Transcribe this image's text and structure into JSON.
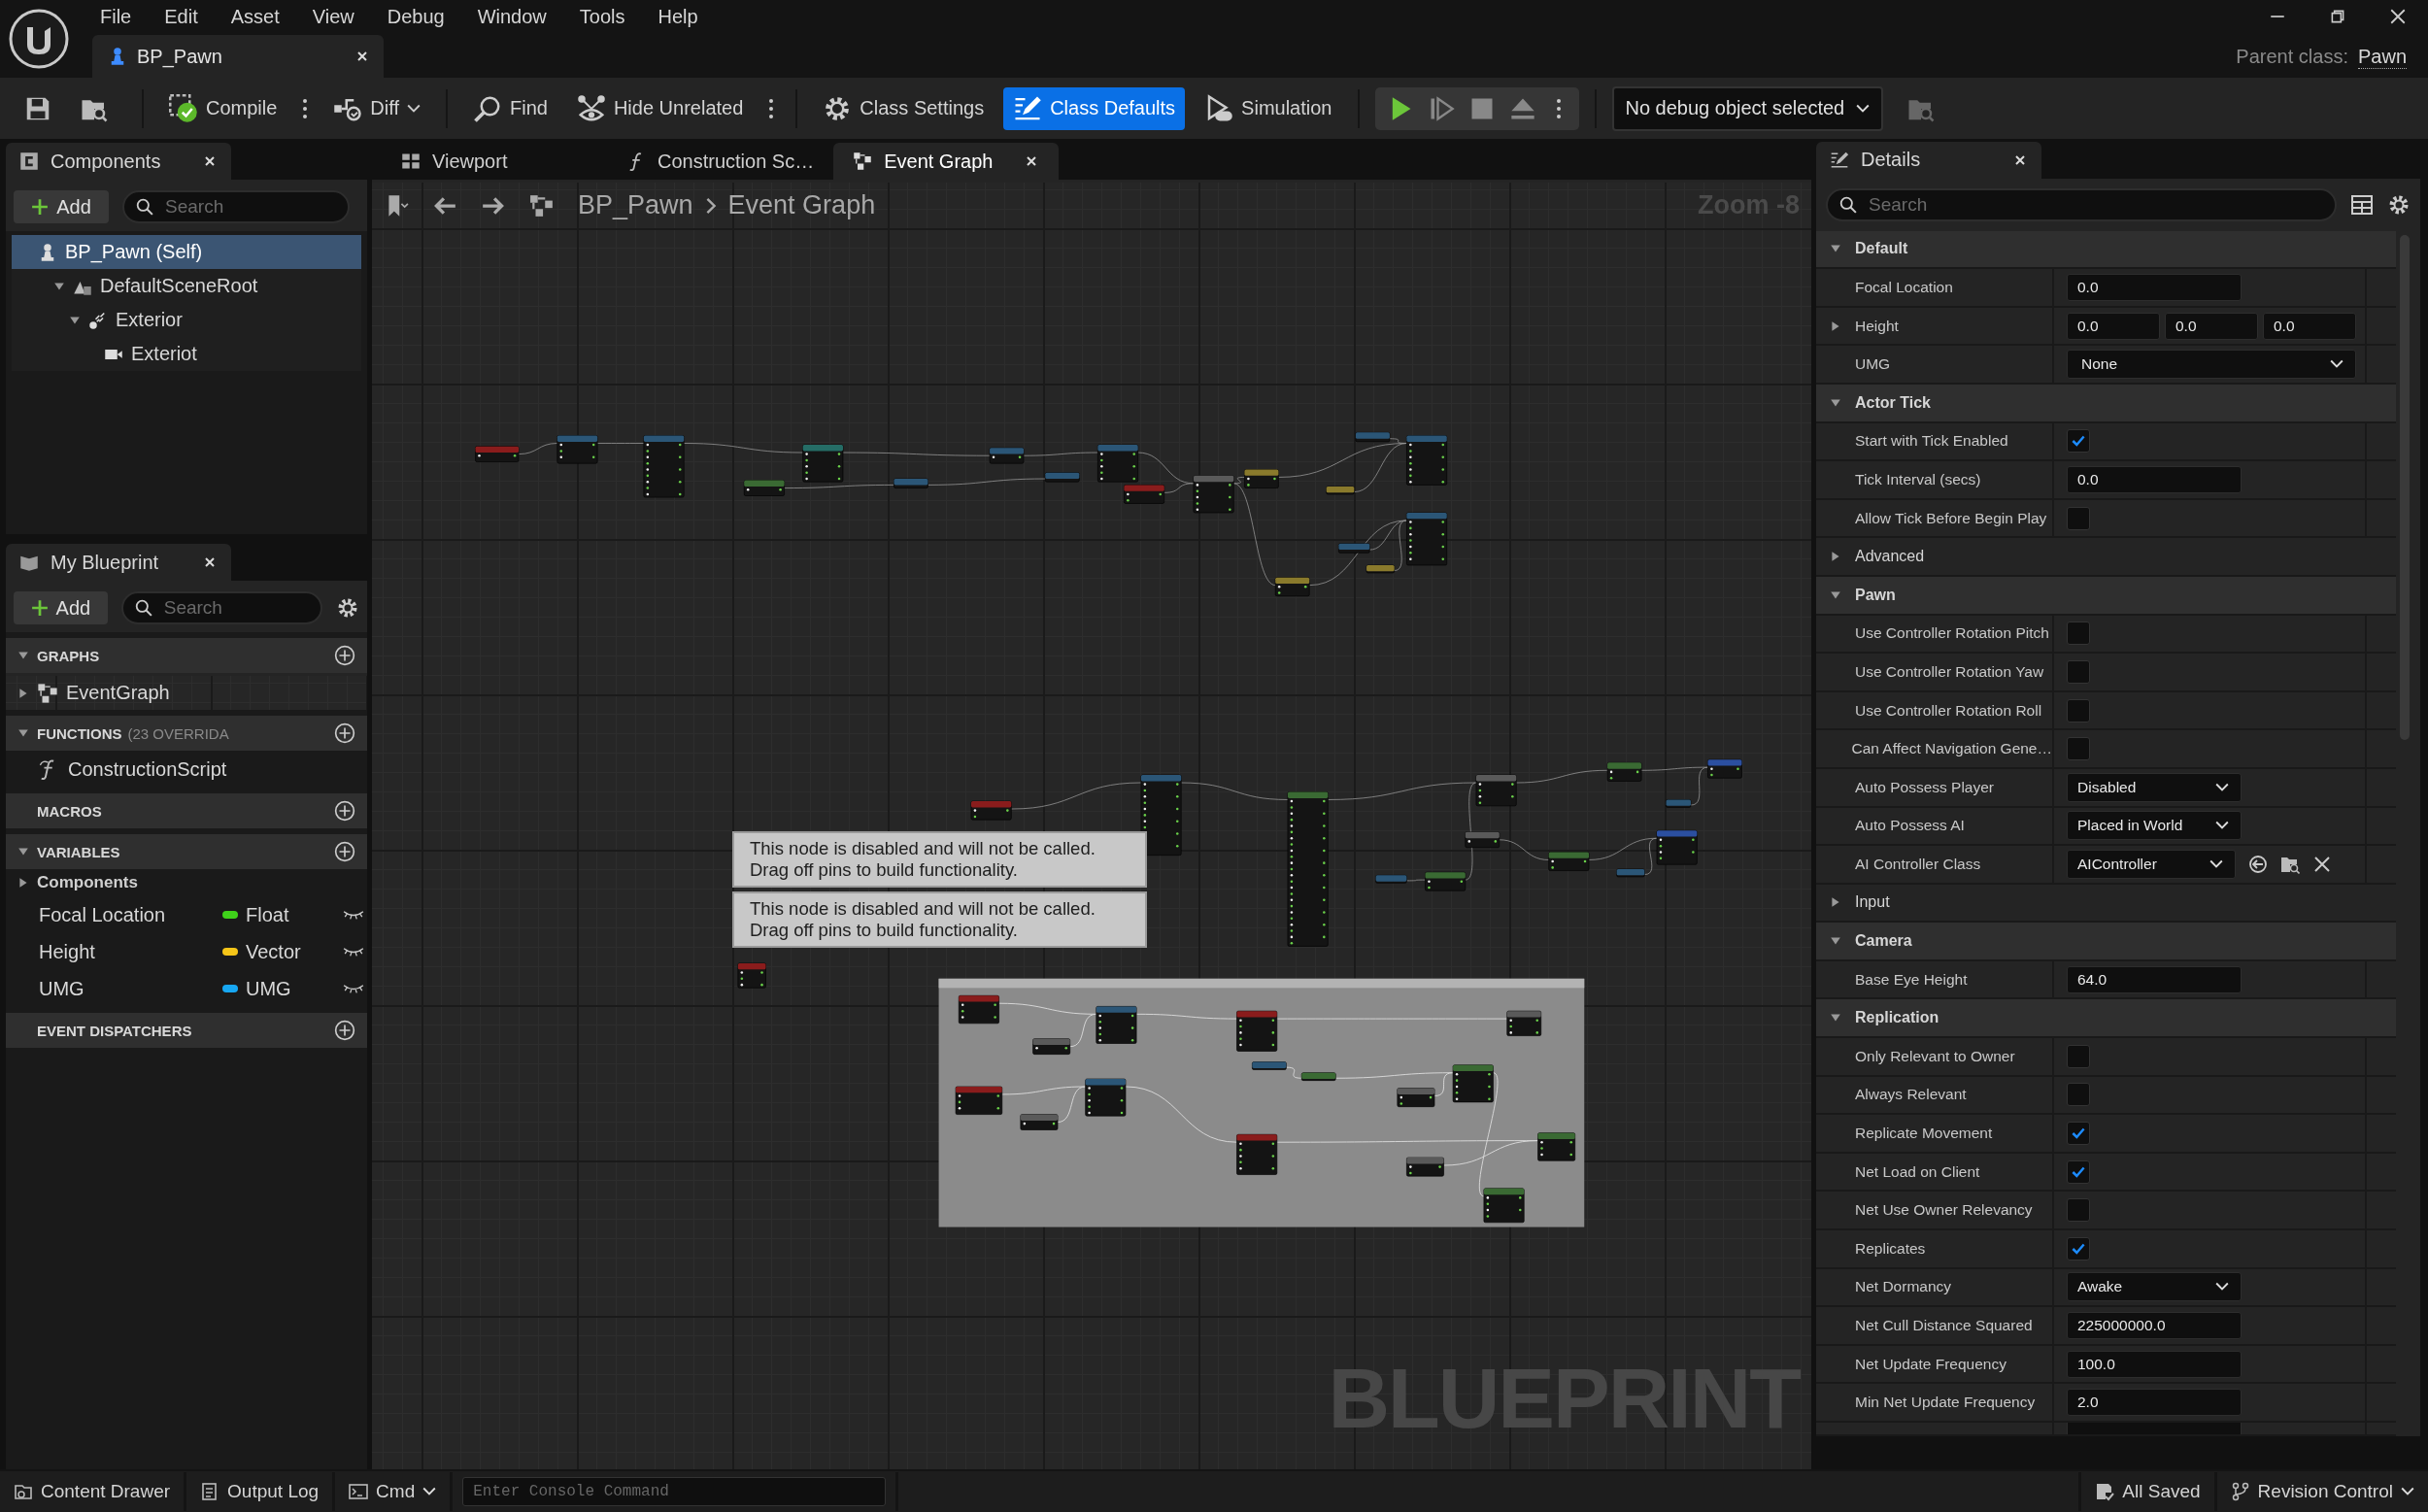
{
  "menu": [
    "File",
    "Edit",
    "Asset",
    "View",
    "Debug",
    "Window",
    "Tools",
    "Help"
  ],
  "document_tab": {
    "label": "BP_Pawn"
  },
  "parent_class": {
    "label": "Parent class:",
    "value": "Pawn"
  },
  "toolbar": {
    "groups": [
      [
        {
          "label": "Compile",
          "kind": "compile",
          "selected": false
        },
        {
          "label": "Diff",
          "kind": "diff",
          "selected": false
        }
      ],
      [
        {
          "label": "Find",
          "kind": "find",
          "selected": false
        },
        {
          "label": "Hide Unrelated",
          "kind": "hide",
          "selected": false
        }
      ],
      [
        {
          "label": "Class Settings",
          "kind": "settings",
          "selected": false
        },
        {
          "label": "Class Defaults",
          "kind": "defaults",
          "selected": true
        },
        {
          "label": "Simulation",
          "kind": "simulation",
          "selected": false
        }
      ]
    ],
    "debug_object": "No debug object selected"
  },
  "components": {
    "title": "Components",
    "add": "Add",
    "search_placeholder": "Search",
    "tree": [
      {
        "label": "BP_Pawn (Self)",
        "kind": "self",
        "selected": true,
        "children": [
          {
            "label": "DefaultSceneRoot",
            "kind": "scene",
            "selected": false,
            "expanded": true,
            "children": [
              {
                "label": "Exterior",
                "kind": "spring",
                "selected": false,
                "expanded": true,
                "children": [
                  {
                    "label": "Exteriot",
                    "kind": "camera",
                    "selected": false
                  }
                ]
              }
            ]
          }
        ]
      }
    ]
  },
  "my_blueprint": {
    "title": "My Blueprint",
    "add": "Add",
    "search_placeholder": "Search",
    "sections": [
      {
        "title": "GRAPHS",
        "expanded": true,
        "items": [
          {
            "label": "EventGraph",
            "kind": "graph",
            "expanded": false
          }
        ]
      },
      {
        "title": "FUNCTIONS",
        "note": "(23 OVERRIDA",
        "expanded": true,
        "items": [
          {
            "label": "ConstructionScript",
            "kind": "function"
          }
        ]
      },
      {
        "title": "MACROS"
      },
      {
        "title": "VARIABLES",
        "expanded": true,
        "items": [
          {
            "label": "Components",
            "kind": "category",
            "expanded": false
          },
          {
            "label": "Focal Location",
            "kind": "variable",
            "type": "Float",
            "color": "#3fd21a"
          },
          {
            "label": "Height",
            "kind": "variable",
            "type": "Vector",
            "color": "#f5c518"
          },
          {
            "label": "UMG",
            "kind": "variable",
            "type": "UMG",
            "color": "#17a7f2"
          }
        ]
      },
      {
        "title": "EVENT DISPATCHERS"
      }
    ]
  },
  "documents": [
    {
      "label": "Viewport",
      "kind": "viewport",
      "selected": false
    },
    {
      "label": "Construction Sc…",
      "kind": "function",
      "selected": false
    },
    {
      "label": "Event Graph",
      "kind": "graph",
      "selected": true
    }
  ],
  "graph": {
    "breadcrumb": [
      "BP_Pawn",
      "Event Graph"
    ],
    "zoom": "Zoom -8",
    "disabled_notes": [
      "This node is disabled and will not be called.\nDrag off pins to build functionality.",
      "This node is disabled and will not be called.\nDrag off pins to build functionality."
    ],
    "watermark": "BLUEPRINT"
  },
  "details": {
    "title": "Details",
    "search_placeholder": "Search",
    "rows": [
      {
        "kind": "section",
        "label": "Default",
        "expanded": true
      },
      {
        "kind": "text",
        "label": "Focal Location",
        "value": "0.0"
      },
      {
        "kind": "vector",
        "label": "Height",
        "expanded": false,
        "values": [
          "0.0",
          "0.0",
          "0.0"
        ]
      },
      {
        "kind": "wide_dropdown",
        "label": "UMG",
        "value": "None"
      },
      {
        "kind": "section",
        "label": "Actor Tick",
        "expanded": true
      },
      {
        "kind": "checkbox",
        "label": "Start with Tick Enabled",
        "checked": true
      },
      {
        "kind": "text",
        "label": "Tick Interval (secs)",
        "value": "0.0"
      },
      {
        "kind": "checkbox",
        "label": "Allow Tick Before Begin Play",
        "checked": false
      },
      {
        "kind": "group",
        "label": "Advanced",
        "expanded": false
      },
      {
        "kind": "section",
        "label": "Pawn",
        "expanded": true
      },
      {
        "kind": "checkbox",
        "label": "Use Controller Rotation Pitch",
        "checked": false
      },
      {
        "kind": "checkbox",
        "label": "Use Controller Rotation Yaw",
        "checked": false
      },
      {
        "kind": "checkbox",
        "label": "Use Controller Rotation Roll",
        "checked": false
      },
      {
        "kind": "checkbox",
        "label": "Can Affect Navigation Gene…",
        "checked": false
      },
      {
        "kind": "dropdown",
        "label": "Auto Possess Player",
        "value": "Disabled"
      },
      {
        "kind": "dropdown",
        "label": "Auto Possess AI",
        "value": "Placed in World"
      },
      {
        "kind": "class",
        "label": "AI Controller Class",
        "value": "AIController"
      },
      {
        "kind": "group",
        "label": "Input",
        "expanded": false
      },
      {
        "kind": "section",
        "label": "Camera",
        "expanded": true
      },
      {
        "kind": "text",
        "label": "Base Eye Height",
        "value": "64.0"
      },
      {
        "kind": "section",
        "label": "Replication",
        "expanded": true
      },
      {
        "kind": "checkbox",
        "label": "Only Relevant to Owner",
        "checked": false
      },
      {
        "kind": "checkbox",
        "label": "Always Relevant",
        "checked": false
      },
      {
        "kind": "checkbox",
        "label": "Replicate Movement",
        "checked": true
      },
      {
        "kind": "checkbox",
        "label": "Net Load on Client",
        "checked": true
      },
      {
        "kind": "checkbox",
        "label": "Net Use Owner Relevancy",
        "checked": false
      },
      {
        "kind": "checkbox",
        "label": "Replicates",
        "checked": true
      },
      {
        "kind": "dropdown",
        "label": "Net Dormancy",
        "value": "Awake"
      },
      {
        "kind": "text",
        "label": "Net Cull Distance Squared",
        "value": "225000000.0"
      },
      {
        "kind": "text",
        "label": "Net Update Frequency",
        "value": "100.0"
      },
      {
        "kind": "text",
        "label": "Min Net Update Frequency",
        "value": "2.0"
      }
    ]
  },
  "status_bar": {
    "left": [
      {
        "label": "Content Drawer",
        "kind": "drawer"
      },
      {
        "label": "Output Log",
        "kind": "log"
      }
    ],
    "cmd": "Cmd",
    "console_placeholder": "Enter Console Command",
    "right": [
      {
        "label": "All Saved",
        "kind": "saved"
      },
      {
        "label": "Revision Control",
        "kind": "revision"
      }
    ]
  }
}
